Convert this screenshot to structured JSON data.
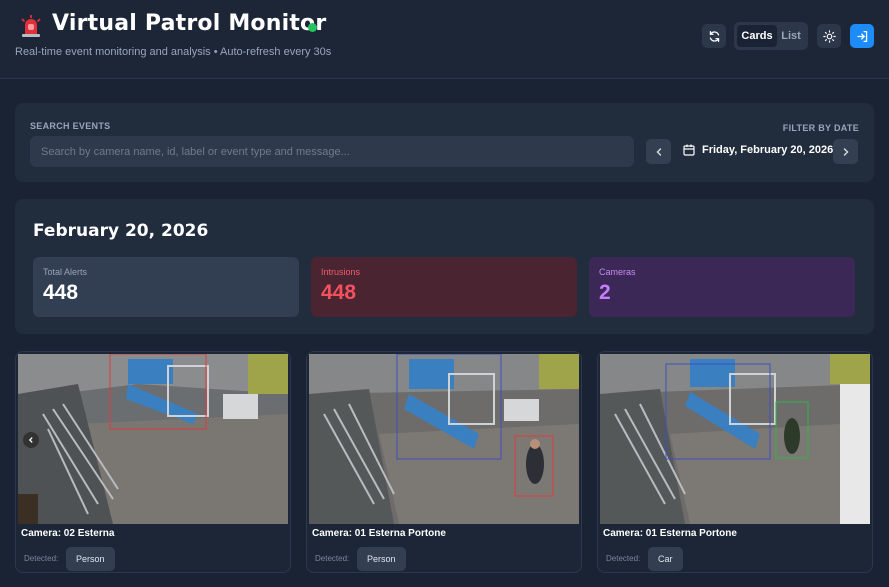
{
  "header": {
    "title": "Virtual Patrol Monitor",
    "subtitle": "Real-time event monitoring and analysis • Auto-refresh every 30s",
    "view_toggle": {
      "cards": "Cards",
      "list": "List",
      "active": "Cards"
    },
    "live_color": "#22c55e",
    "accent_color": "#1d8cf8"
  },
  "search": {
    "label": "SEARCH EVENTS",
    "placeholder": "Search by camera name, id, label or event type and message...",
    "value": "",
    "filter_label": "FILTER BY DATE",
    "date": "Friday, February 20, 2026"
  },
  "summary": {
    "date_title": "February 20, 2026",
    "stats": [
      {
        "label": "Total Alerts",
        "value": "448",
        "color": "#ffffff"
      },
      {
        "label": "Intrusions",
        "value": "448",
        "color": "#f4515f"
      },
      {
        "label": "Cameras",
        "value": "2",
        "color": "#c77dff"
      }
    ]
  },
  "cards": [
    {
      "camera": "Camera: 02 Esterna",
      "detected_label": "Detected:",
      "detected": "Person"
    },
    {
      "camera": "Camera: 01 Esterna Portone",
      "detected_label": "Detected:",
      "detected": "Person"
    },
    {
      "camera": "Camera: 01 Esterna Portone",
      "detected_label": "Detected:",
      "detected": "Car"
    }
  ],
  "icons": {
    "siren": "siren-icon",
    "refresh": "refresh-icon",
    "theme": "sun-icon",
    "login": "login-icon",
    "calendar": "calendar-icon",
    "prev": "chevron-left-icon",
    "next": "chevron-right-icon"
  }
}
